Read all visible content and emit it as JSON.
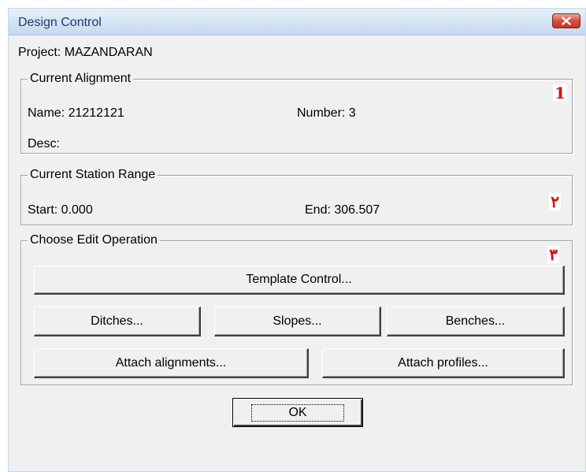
{
  "window": {
    "title": "Design Control",
    "close_icon": "close-icon"
  },
  "project": {
    "label": "Project: MAZANDARAN"
  },
  "current_alignment": {
    "title": "Current Alignment",
    "name": "Name: 21212121",
    "number": "Number: 3",
    "desc": "Desc:",
    "marker": "1"
  },
  "station_range": {
    "title": "Current Station Range",
    "start": "Start: 0.000",
    "end": "End: 306.507",
    "marker": "٢"
  },
  "edit_operation": {
    "title": "Choose Edit Operation",
    "marker": "٣",
    "buttons": {
      "template_control": "Template Control...",
      "ditches": "Ditches...",
      "slopes": "Slopes...",
      "benches": "Benches...",
      "attach_alignments": "Attach alignments...",
      "attach_profiles": "Attach profiles..."
    }
  },
  "ok_label": "OK",
  "colors": {
    "marker": "#e00000",
    "title_text": "#1f3a66"
  }
}
